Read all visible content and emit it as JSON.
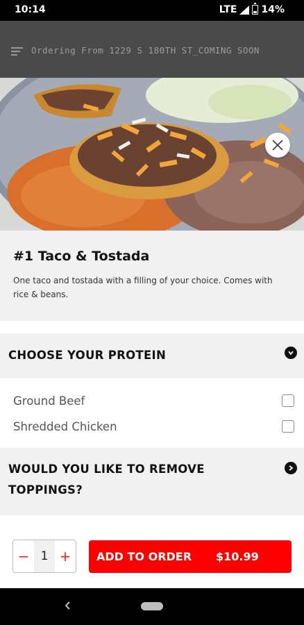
{
  "status_bar": {
    "time": "10:14",
    "network": "LTE",
    "battery": "14%"
  },
  "app_header": {
    "title": "Ordering From 1229 S 180TH ST_COMING SOON",
    "menu_icon": "hamburger-menu-icon"
  },
  "modal": {
    "close_icon": "close-icon",
    "item": {
      "title": "#1 Taco & Tostada",
      "description": "One taco and tostada with a filling of your choice. Comes with rice & beans."
    },
    "sections": [
      {
        "title": "CHOOSE YOUR PROTEIN",
        "icon": "chevron-down-icon",
        "options": [
          {
            "label": "Ground Beef",
            "checked": false
          },
          {
            "label": "Shredded Chicken",
            "checked": false
          }
        ]
      },
      {
        "title": "WOULD YOU LIKE TO REMOVE TOPPINGS?",
        "title_line1": "WOULD YOU LIKE TO REMOVE",
        "title_line2": "TOPPINGS?",
        "icon": "chevron-right-icon"
      }
    ],
    "quantity": {
      "minus": "−",
      "value": "1",
      "plus": "+"
    },
    "add_to_order": {
      "label": "ADD TO ORDER",
      "price": "$10.99"
    }
  },
  "colors": {
    "accent": "#ff0000",
    "background": "#f1f1f1",
    "header_dim": "#4a4a4a"
  }
}
